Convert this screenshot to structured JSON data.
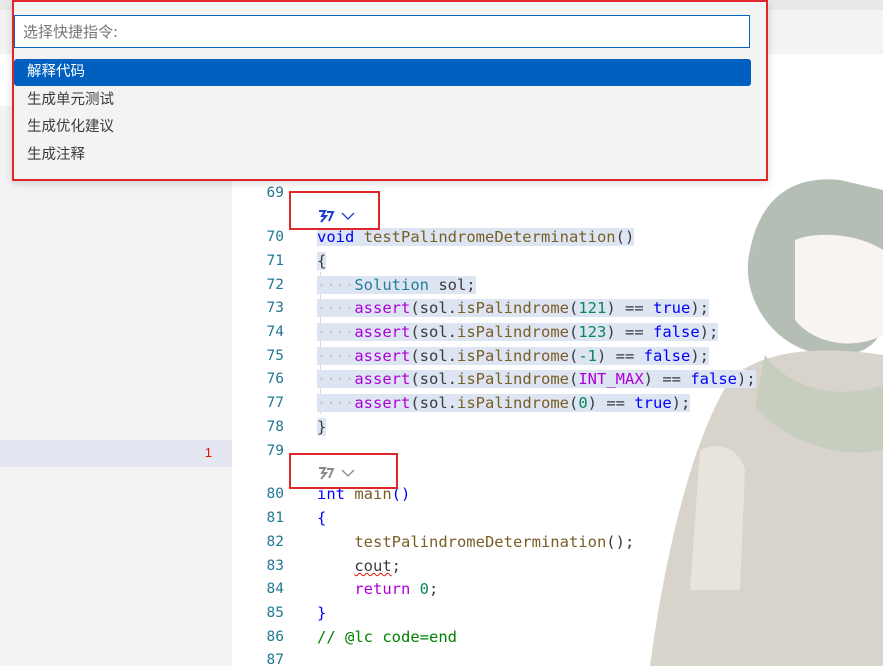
{
  "quick_pick": {
    "placeholder": "选择快捷指令:",
    "items": [
      {
        "label": "解释代码",
        "active": true
      },
      {
        "label": "生成单元测试",
        "active": false
      },
      {
        "label": "生成优化建议",
        "active": false
      },
      {
        "label": "生成注释",
        "active": false
      }
    ]
  },
  "sidebar": {
    "problem_count": "1"
  },
  "editor": {
    "line_numbers": [
      "69",
      "70",
      "71",
      "72",
      "73",
      "74",
      "75",
      "76",
      "77",
      "78",
      "79",
      "80",
      "81",
      "82",
      "83",
      "84",
      "85",
      "86",
      "87"
    ],
    "code": {
      "l70": {
        "kw": "void",
        "fn": "testPalindromeDetermination",
        "p": "()"
      },
      "l71": "{",
      "l72": {
        "type": "Solution",
        "rest": " sol;"
      },
      "l73": {
        "fn": "assert",
        "a": "(sol.",
        "call": "isPalindrome",
        "b": "(",
        "n": "121",
        "c": ") == ",
        "v": "true",
        "d": ");"
      },
      "l74": {
        "fn": "assert",
        "a": "(sol.",
        "call": "isPalindrome",
        "b": "(",
        "n": "123",
        "c": ") == ",
        "v": "false",
        "d": ");"
      },
      "l75": {
        "fn": "assert",
        "a": "(sol.",
        "call": "isPalindrome",
        "b": "(",
        "n": "-1",
        "c": ") == ",
        "v": "false",
        "d": ");"
      },
      "l76": {
        "fn": "assert",
        "a": "(sol.",
        "call": "isPalindrome",
        "b": "(",
        "n": "INT_MAX",
        "c": ") == ",
        "v": "false",
        "d": ");"
      },
      "l77": {
        "fn": "assert",
        "a": "(sol.",
        "call": "isPalindrome",
        "b": "(",
        "n": "0",
        "c": ") == ",
        "v": "true",
        "d": ");"
      },
      "l78": "}",
      "l80": {
        "kw": "int",
        "fn": "main",
        "p": "()"
      },
      "l81": "{",
      "l82": {
        "fn": "testPalindromeDetermination",
        "p": "();"
      },
      "l83": {
        "id": "cout",
        "p": ";"
      },
      "l84": {
        "kw": "return",
        "n": "0",
        "p": ";"
      },
      "l85": "}",
      "l86": "// @lc code=end"
    }
  },
  "colors": {
    "accent": "#0060c0",
    "annotation_box": "#e0252b",
    "line_number": "#237893"
  },
  "icons": {
    "codelens": "ai-assistant-icon",
    "dropdown": "chevron-down-icon"
  }
}
